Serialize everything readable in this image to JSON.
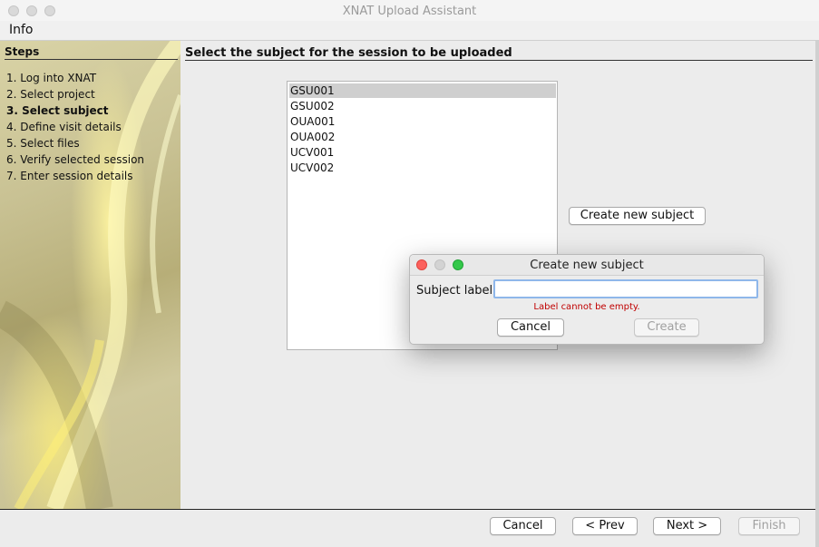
{
  "window": {
    "title": "XNAT Upload Assistant"
  },
  "menu": {
    "info": "Info"
  },
  "steps": {
    "heading": "Steps",
    "items": [
      {
        "label": "1. Log into XNAT",
        "current": false
      },
      {
        "label": "2. Select project",
        "current": false
      },
      {
        "label": "3. Select subject",
        "current": true
      },
      {
        "label": "4. Define visit details",
        "current": false
      },
      {
        "label": "5. Select files",
        "current": false
      },
      {
        "label": "6. Verify selected session",
        "current": false
      },
      {
        "label": "7. Enter session details",
        "current": false
      }
    ]
  },
  "main": {
    "heading": "Select the subject for the session to be uploaded",
    "subjects": [
      "GSU001",
      "GSU002",
      "OUA001",
      "OUA002",
      "UCV001",
      "UCV002"
    ],
    "selected_subject": "GSU001",
    "create_new_subject_label": "Create new subject"
  },
  "dialog": {
    "title": "Create new subject",
    "subject_label": "Subject label",
    "subject_value": "",
    "error": "Label cannot be empty.",
    "cancel_label": "Cancel",
    "create_label": "Create"
  },
  "footer": {
    "cancel_label": "Cancel",
    "prev_label": "< Prev",
    "next_label": "Next >",
    "finish_label": "Finish"
  },
  "colors": {
    "error_text": "#c00000",
    "dialog_close": "#fc615d",
    "dialog_maximize": "#34c84a",
    "input_focus": "#8fb7ea"
  }
}
